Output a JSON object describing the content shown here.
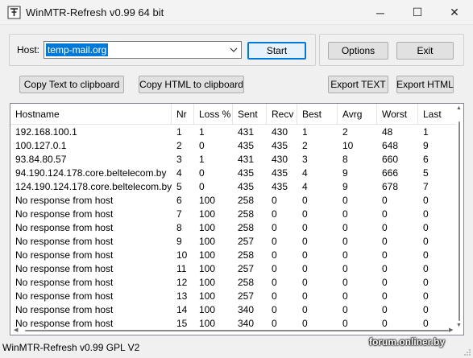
{
  "window": {
    "title": "WinMTR-Refresh v0.99 64 bit",
    "minimize_glyph": "─",
    "maximize_glyph": "☐",
    "close_glyph": "✕"
  },
  "host": {
    "label": "Host:",
    "value": "temp-mail.org"
  },
  "buttons": {
    "start": "Start",
    "options": "Options",
    "exit": "Exit",
    "copy_text": "Copy Text to clipboard",
    "copy_html": "Copy HTML to clipboard",
    "export_text": "Export TEXT",
    "export_html": "Export HTML"
  },
  "table": {
    "columns": [
      "Hostname",
      "Nr",
      "Loss %",
      "Sent",
      "Recv",
      "Best",
      "Avrg",
      "Worst",
      "Last"
    ],
    "rows": [
      [
        "192.168.100.1",
        "1",
        "1",
        "431",
        "430",
        "1",
        "2",
        "48",
        "1"
      ],
      [
        "100.127.0.1",
        "2",
        "0",
        "435",
        "435",
        "2",
        "10",
        "648",
        "9"
      ],
      [
        "93.84.80.57",
        "3",
        "1",
        "431",
        "430",
        "3",
        "8",
        "660",
        "6"
      ],
      [
        "94.190.124.178.core.beltelecom.by",
        "4",
        "0",
        "435",
        "435",
        "4",
        "9",
        "666",
        "5"
      ],
      [
        "124.190.124.178.core.beltelecom.by",
        "5",
        "0",
        "435",
        "435",
        "4",
        "9",
        "678",
        "7"
      ],
      [
        "No response from host",
        "6",
        "100",
        "258",
        "0",
        "0",
        "0",
        "0",
        "0"
      ],
      [
        "No response from host",
        "7",
        "100",
        "258",
        "0",
        "0",
        "0",
        "0",
        "0"
      ],
      [
        "No response from host",
        "8",
        "100",
        "258",
        "0",
        "0",
        "0",
        "0",
        "0"
      ],
      [
        "No response from host",
        "9",
        "100",
        "257",
        "0",
        "0",
        "0",
        "0",
        "0"
      ],
      [
        "No response from host",
        "10",
        "100",
        "258",
        "0",
        "0",
        "0",
        "0",
        "0"
      ],
      [
        "No response from host",
        "11",
        "100",
        "257",
        "0",
        "0",
        "0",
        "0",
        "0"
      ],
      [
        "No response from host",
        "12",
        "100",
        "258",
        "0",
        "0",
        "0",
        "0",
        "0"
      ],
      [
        "No response from host",
        "13",
        "100",
        "257",
        "0",
        "0",
        "0",
        "0",
        "0"
      ],
      [
        "No response from host",
        "14",
        "100",
        "340",
        "0",
        "0",
        "0",
        "0",
        "0"
      ],
      [
        "No response from host",
        "15",
        "100",
        "340",
        "0",
        "0",
        "0",
        "0",
        "0"
      ]
    ]
  },
  "status_bar": "WinMTR-Refresh v0.99 GPL V2",
  "watermark": "forum.onliner.by",
  "colors": {
    "accent": "#0078d7",
    "window_bg": "#f0f0f0",
    "list_bg": "#ffffff"
  }
}
